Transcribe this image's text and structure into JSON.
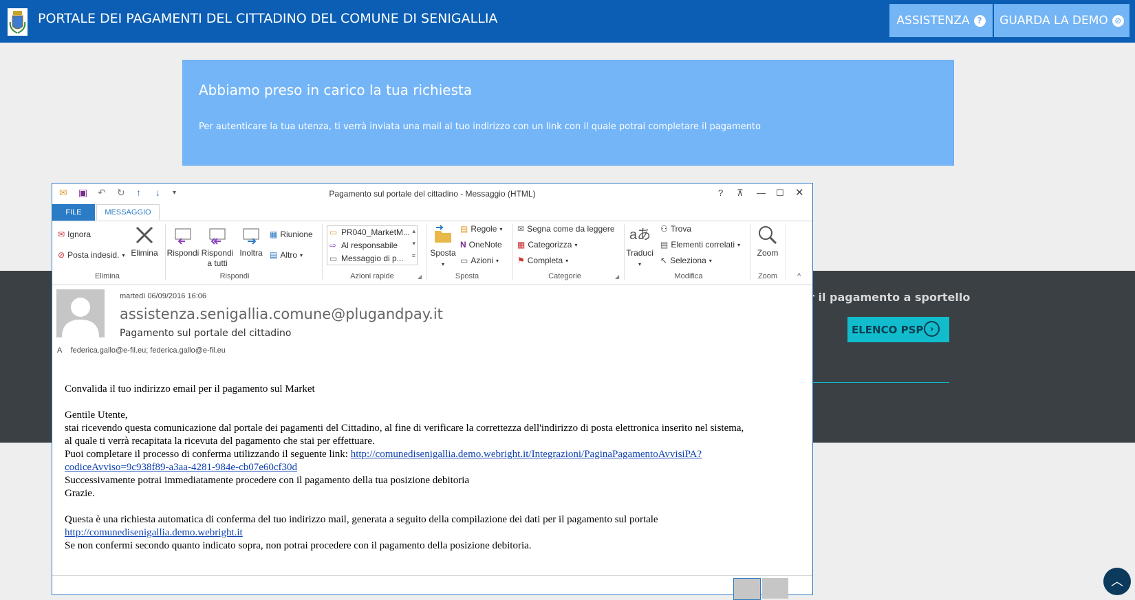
{
  "header": {
    "title": "PORTALE DEI PAGAMENTI DEL CITTADINO DEL COMUNE DI SENIGALLIA",
    "assistenza_label": "ASSISTENZA",
    "demo_label": "GUARDA LA DEMO",
    "colors": {
      "bar": "#0b5eb4",
      "button": "#74b5f5"
    }
  },
  "alert": {
    "title": "Abbiamo preso in carico la tua richiesta",
    "text": "Per autenticare la tua utenza, ti verrà inviata una mail al tuo indirizzo con un link con il quale potrai completare il pagamento"
  },
  "psp": {
    "text": "r il pagamento a sportello",
    "button_label": "ELENCO PSP"
  },
  "outlook": {
    "window_title": "Pagamento sul portale del cittadino - Messaggio (HTML)",
    "tabs": {
      "file": "FILE",
      "message": "MESSAGGIO"
    },
    "ribbon": {
      "elimina": {
        "ignora": "Ignora",
        "posta_indesid": "Posta indesid.",
        "elimina": "Elimina",
        "group": "Elimina"
      },
      "rispondi": {
        "rispondi": "Rispondi",
        "rispondi_tutti_1": "Rispondi",
        "rispondi_tutti_2": "a tutti",
        "inoltra": "Inoltra",
        "riunione": "Riunione",
        "altro": "Altro",
        "group": "Rispondi"
      },
      "azioni_rapide": {
        "items": [
          "PR040_MarketM...",
          "Al responsabile",
          "Messaggio di p..."
        ],
        "group": "Azioni rapide"
      },
      "sposta": {
        "sposta": "Sposta",
        "regole": "Regole",
        "onenote": "OneNote",
        "azioni": "Azioni",
        "group": "Sposta"
      },
      "categorie": {
        "segna": "Segna come da leggere",
        "categorizza": "Categorizza",
        "completa": "Completa",
        "group": "Categorie"
      },
      "modifica": {
        "traduci": "Traduci",
        "trova": "Trova",
        "correlati": "Elementi correlati",
        "seleziona": "Seleziona",
        "group": "Modifica"
      },
      "zoom": {
        "zoom": "Zoom",
        "group": "Zoom"
      }
    },
    "message": {
      "date": "martedì 06/09/2016 16:06",
      "from": "assistenza.senigallia.comune@plugandpay.it",
      "subject": "Pagamento sul portale del cittadino",
      "to_label": "A",
      "to": "federica.gallo@e-fil.eu; federica.gallo@e-fil.eu",
      "body": {
        "line1": "Convalida il tuo indirizzo email per il pagamento sul Market",
        "greeting": "Gentile Utente,",
        "p1": "stai ricevendo questa comunicazione dal portale dei pagamenti del Cittadino, al fine di verificare la correttezza dell'indirizzo di posta elettronica inserito nel sistema,",
        "p2": "al quale ti verrà recapitata la ricevuta del pagamento che stai per effettuare.",
        "p3": "Puoi completare il processo di conferma utilizzando il seguente link: ",
        "link1a": "http://comunedisenigallia.demo.webright.it/Integrazioni/PaginaPagamentoAvvisiPA?",
        "link1b": "codiceAvviso=9c938f89-a3aa-4281-984e-cb07e60cf30d",
        "p4": "Successivamente potrai immediatamente procedere con il pagamento della tua posizione debitoria",
        "p5": "Grazie.",
        "p6": "Questa è una richiesta automatica di conferma del tuo indirizzo mail, generata a seguito della compilazione dei dati per il pagamento sul portale",
        "link2": "http://comunedisenigallia.demo.webright.it",
        "p7": "Se non confermi secondo quanto indicato sopra, non potrai procedere con il pagamento della posizione debitoria."
      }
    }
  }
}
